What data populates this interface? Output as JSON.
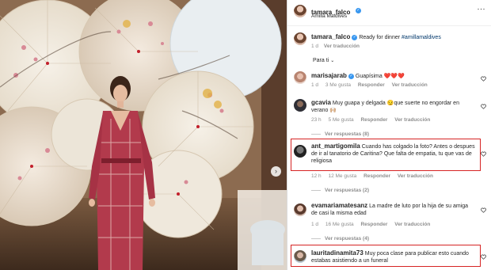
{
  "header": {
    "username": "tamara_falco",
    "location": "Amilla Maldives",
    "more": "⋮"
  },
  "caption": {
    "username": "tamara_falco",
    "text": "Ready for dinner",
    "hashtag": "#amillamaldives",
    "time": "1 d",
    "translate": "Ver traducción"
  },
  "section_label": "Para ti",
  "comments": [
    {
      "username": "marisajarab",
      "verified": true,
      "text": "Guapísima ❤️❤️❤️",
      "time": "1 d",
      "likes": "3 Me gusta",
      "reply": "Responder",
      "translate": "Ver traducción"
    },
    {
      "username": "gcavia",
      "text": "Muy guapa y delgada 😏que suerte no engordar en verano 🙌🏼",
      "time": "23 h",
      "likes": "5 Me gusta",
      "reply": "Responder",
      "translate": "Ver traducción",
      "replies": "Ver respuestas (8)"
    },
    {
      "username": "ant_martigomila",
      "text": "Cuando has colgado la foto? Antes o despues de ir al tanatorio de Caritina? Que falta de empatia, tu que vas de religiosa",
      "time": "12 h",
      "likes": "12 Me gusta",
      "reply": "Responder",
      "translate": "Ver traducción",
      "replies": "Ver respuestas (2)"
    },
    {
      "username": "evamariamatesanz",
      "text": "La madre de luto por la hija de su amiga de casi la misma edad",
      "time": "1 d",
      "likes": "16 Me gusta",
      "reply": "Responder",
      "translate": "Ver traducción",
      "replies": "Ver respuestas (4)"
    },
    {
      "username": "lauritadinamita73",
      "text": "Muy poca clase para publicar esto cuando estabas asistiendo a un funeral",
      "time": "",
      "likes": "",
      "reply": "",
      "translate": ""
    }
  ],
  "colors": {
    "highlight_box": "#d62424",
    "link": "#00376b",
    "verified": "#3897f0",
    "muted": "#8e8e8e"
  }
}
